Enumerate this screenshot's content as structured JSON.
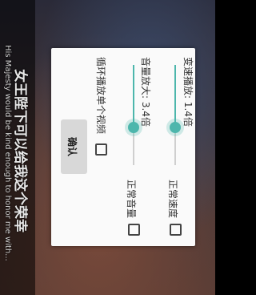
{
  "subtitles": {
    "cn": "女王陛下可以给我这个荣幸",
    "en": "His Majesty would be kind enough to honor me with..."
  },
  "dialog": {
    "speed": {
      "label": "变速播放: 1.4倍",
      "value": 1.4,
      "reset_label": "正常速度"
    },
    "volume": {
      "label": "音量放大: 3.4倍",
      "value": 3.4,
      "reset_label": "正常音量"
    },
    "loop": {
      "label": "循环播放单个视频"
    },
    "confirm_label": "确认"
  },
  "colors": {
    "accent": "#4db6ac"
  }
}
